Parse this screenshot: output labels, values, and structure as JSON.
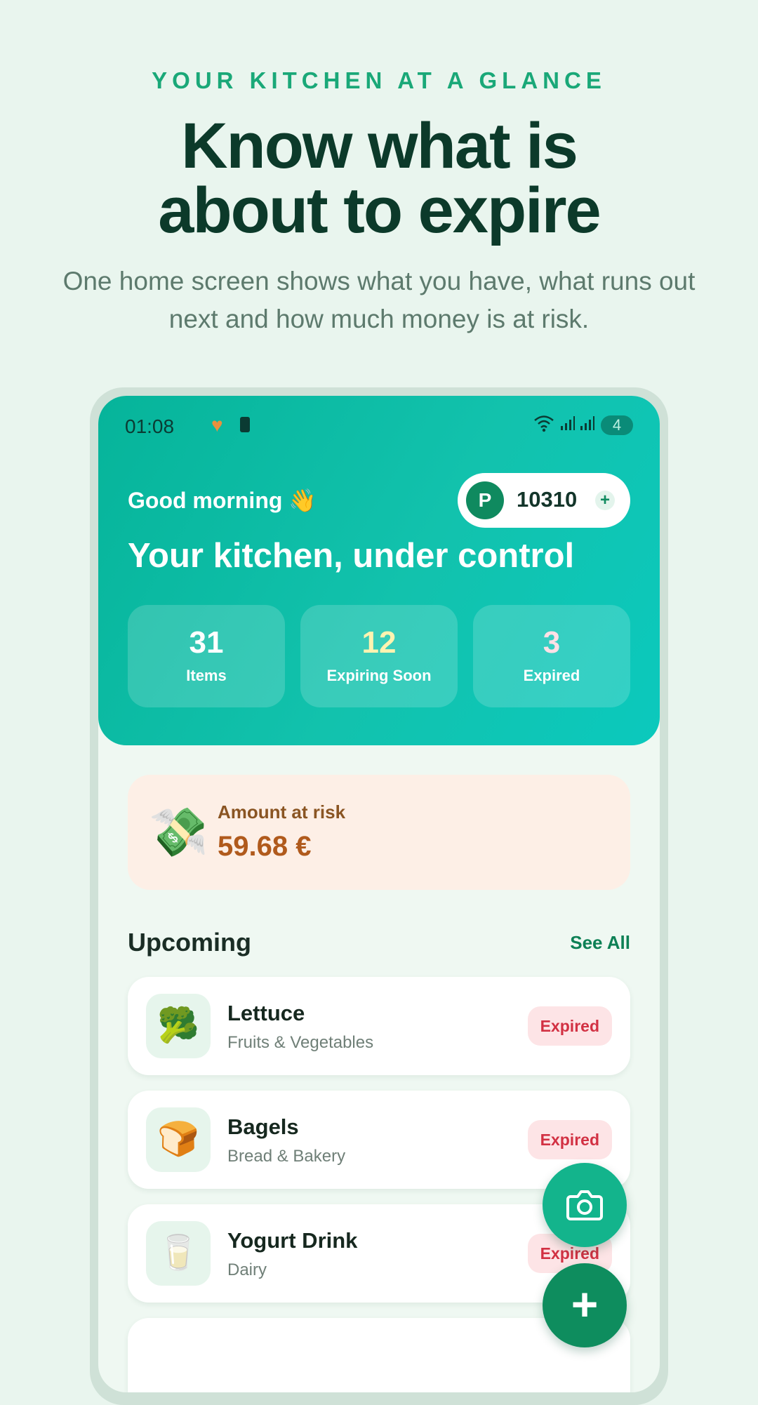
{
  "promo": {
    "eyebrow": "YOUR KITCHEN AT A GLANCE",
    "headline_line1": "Know what is",
    "headline_line2": "about to expire",
    "subhead": "One home screen shows what you have, what runs out next and how much money is at risk."
  },
  "status_bar": {
    "time": "01:08",
    "heart_icon": "♥",
    "battery": "4"
  },
  "header": {
    "greeting": "Good morning 👋",
    "title": "Your kitchen, under control",
    "points": {
      "badge": "P",
      "value": "10310",
      "plus": "+"
    },
    "stats": [
      {
        "value": "31",
        "label": "Items",
        "color": "#ffffff"
      },
      {
        "value": "12",
        "label": "Expiring Soon",
        "color": "#fff3b0"
      },
      {
        "value": "3",
        "label": "Expired",
        "color": "#ffe0e6"
      }
    ]
  },
  "risk": {
    "icon": "💸",
    "label": "Amount at risk",
    "value": "59.68 €"
  },
  "upcoming": {
    "title": "Upcoming",
    "see_all": "See All",
    "items": [
      {
        "icon": "🥦",
        "name": "Lettuce",
        "category": "Fruits & Vegetables",
        "status": "Expired"
      },
      {
        "icon": "🍞",
        "name": "Bagels",
        "category": "Bread & Bakery",
        "status": "Expired"
      },
      {
        "icon": "🥛",
        "name": "Yogurt Drink",
        "category": "Dairy",
        "status": "Expired"
      }
    ]
  },
  "fab": {
    "add": "+",
    "camera_icon": "camera-icon"
  },
  "colors": {
    "accent": "#13b48c",
    "brand_dark": "#0c3a2a",
    "expired": "#d23143"
  }
}
